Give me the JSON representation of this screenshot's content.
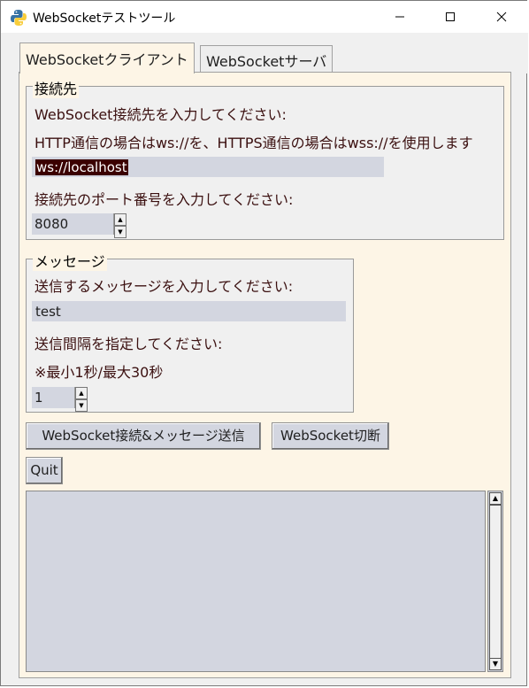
{
  "window": {
    "title": "WebSocketテストツール"
  },
  "tabs": [
    {
      "label": "WebSocketクライアント"
    },
    {
      "label": "WebSocketサーバ"
    }
  ],
  "connection_group": {
    "legend": "接続先",
    "prompt": "WebSocket接続先を入力してください:",
    "note": "HTTP通信の場合はws://を、HTTPS通信の場合はwss://を使用します",
    "url_value": "ws://localhost",
    "port_prompt": "接続先のポート番号を入力してください:",
    "port_value": "8080"
  },
  "message_group": {
    "legend": "メッセージ",
    "prompt": "送信するメッセージを入力してください:",
    "message_value": "test",
    "interval_prompt": "送信間隔を指定してください:",
    "interval_note": "※最小1秒/最大30秒",
    "interval_value": "1"
  },
  "buttons": {
    "connect_send": "WebSocket接続&メッセージ送信",
    "disconnect": "WebSocket切断",
    "quit": "Quit"
  },
  "icons": {
    "minimize": "minimize-icon",
    "maximize": "maximize-icon",
    "close": "close-icon",
    "app": "python-icon"
  },
  "colors": {
    "tab_background": "#fdf5e6",
    "field_background": "#d3d6e0",
    "label_text": "#3b1010",
    "selection": "#3b0000"
  }
}
